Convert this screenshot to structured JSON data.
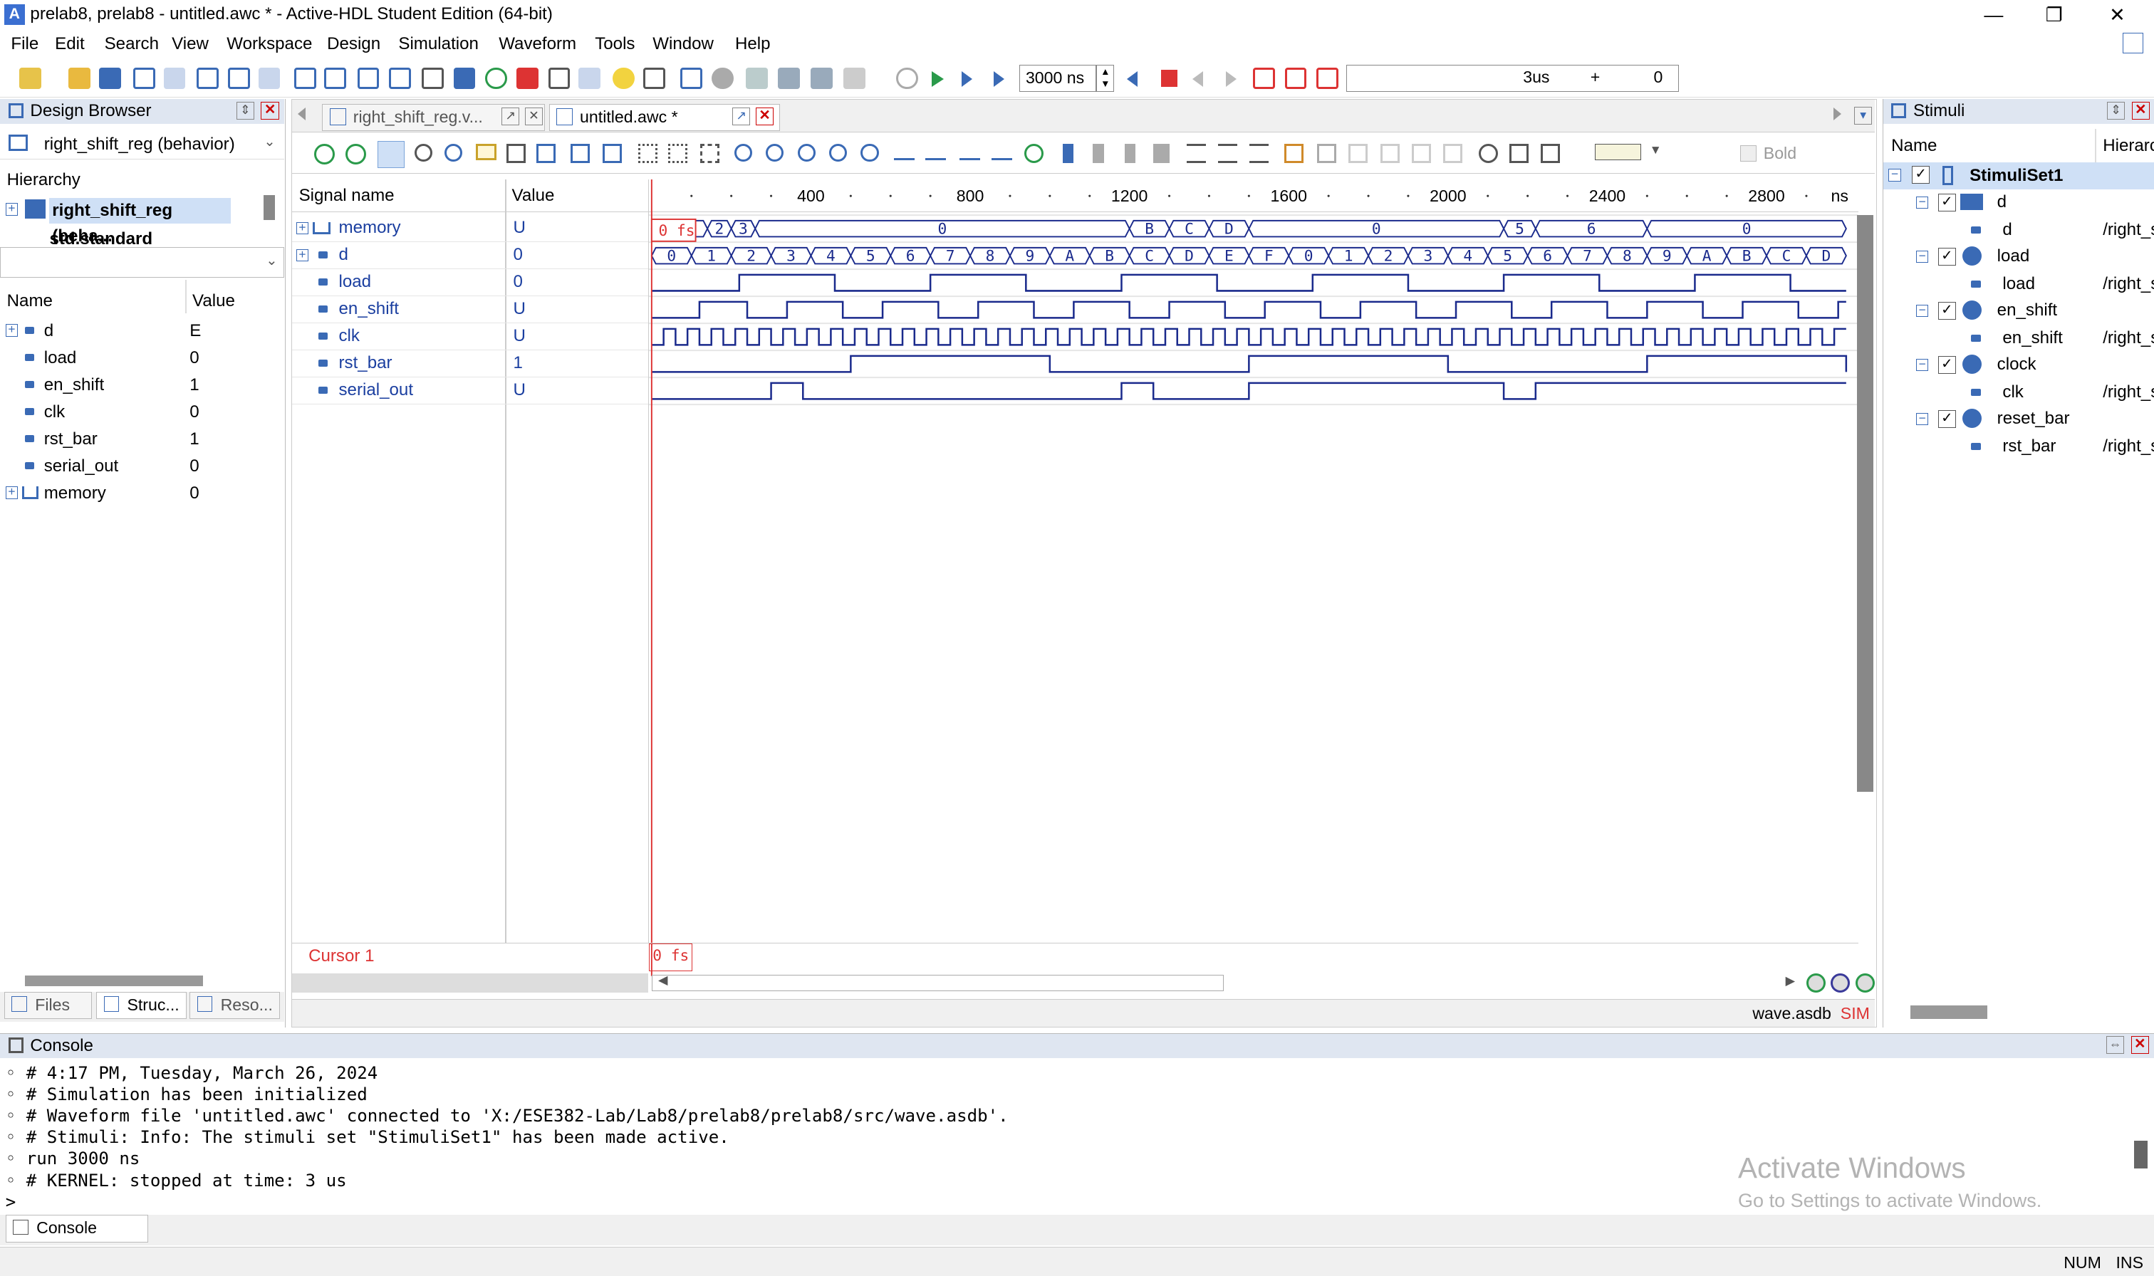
{
  "window": {
    "title": "prelab8, prelab8 - untitled.awc * - Active-HDL Student Edition (64-bit)",
    "minimize": "—",
    "maximize": "❐",
    "close": "✕"
  },
  "menu": [
    "File",
    "Edit",
    "Search",
    "View",
    "Workspace",
    "Design",
    "Simulation",
    "Waveform",
    "Tools",
    "Window",
    "Help"
  ],
  "toolbar": {
    "run_time": "3000 ns",
    "time_display": "3us",
    "plus": "+",
    "counter": "0"
  },
  "design_browser": {
    "title": "Design Browser",
    "top_selector": "right_shift_reg (behavior)",
    "hierarchy_label": "Hierarchy",
    "hierarchy_items": [
      "right_shift_reg (beha...",
      "std.standard"
    ],
    "columns": {
      "name": "Name",
      "value": "Value"
    },
    "signals": [
      {
        "name": "d",
        "value": "E"
      },
      {
        "name": "load",
        "value": "0"
      },
      {
        "name": "en_shift",
        "value": "1"
      },
      {
        "name": "clk",
        "value": "0"
      },
      {
        "name": "rst_bar",
        "value": "1"
      },
      {
        "name": "serial_out",
        "value": "0"
      },
      {
        "name": "memory",
        "value": "0"
      }
    ],
    "tabs": [
      "Files",
      "Struc...",
      "Reso..."
    ]
  },
  "editor_tabs": [
    {
      "label": "right_shift_reg.v..."
    },
    {
      "label": "untitled.awc *"
    }
  ],
  "waveform": {
    "toolbar_bold": "Bold",
    "col_signal": "Signal name",
    "col_value": "Value",
    "time_unit": "ns",
    "ticks": [
      "400",
      "800",
      "1200",
      "1600",
      "2000",
      "2400",
      "2800"
    ],
    "cursor_flag": "0 fs",
    "cursor_name": "Cursor 1",
    "cursor_time": "0 fs",
    "status_file": "wave.asdb",
    "status_mode": "SIM",
    "signals": [
      {
        "name": "memory",
        "value": "U"
      },
      {
        "name": "d",
        "value": "0"
      },
      {
        "name": "load",
        "value": "0"
      },
      {
        "name": "en_shift",
        "value": "U"
      },
      {
        "name": "clk",
        "value": "U"
      },
      {
        "name": "rst_bar",
        "value": "1"
      },
      {
        "name": "serial_out",
        "value": "U"
      }
    ],
    "memory_segments": [
      {
        "start": 0,
        "end": 60,
        "label": "U"
      },
      {
        "start": 60,
        "end": 140,
        "label": ""
      },
      {
        "start": 140,
        "end": 200,
        "label": "2"
      },
      {
        "start": 200,
        "end": 260,
        "label": "3"
      },
      {
        "start": 260,
        "end": 1200,
        "label": "0"
      },
      {
        "start": 1200,
        "end": 1300,
        "label": "B"
      },
      {
        "start": 1300,
        "end": 1400,
        "label": "C"
      },
      {
        "start": 1400,
        "end": 1500,
        "label": "D"
      },
      {
        "start": 1500,
        "end": 2140,
        "label": "0"
      },
      {
        "start": 2140,
        "end": 2220,
        "label": "5"
      },
      {
        "start": 2220,
        "end": 2500,
        "label": "6"
      },
      {
        "start": 2500,
        "end": 3000,
        "label": "0"
      }
    ],
    "d_values": [
      "0",
      "1",
      "2",
      "3",
      "4",
      "5",
      "6",
      "7",
      "8",
      "9",
      "A",
      "B",
      "C",
      "D",
      "E",
      "F",
      "0",
      "1",
      "2",
      "3",
      "4",
      "5",
      "6",
      "7",
      "8",
      "9",
      "A",
      "B",
      "C",
      "D"
    ],
    "load_edges": [
      220,
      460,
      700,
      940,
      1180,
      1420,
      1660,
      1900,
      2140,
      2380,
      2620,
      2860
    ],
    "en_shift_edges": [
      120,
      240,
      340,
      480,
      580,
      720,
      820,
      960,
      1060,
      1200,
      1300,
      1440,
      1540,
      1680,
      1780,
      1920,
      2020,
      2160,
      2260,
      2400,
      2500,
      2640,
      2740,
      2880,
      2980
    ],
    "clk_period": 60,
    "rst_bar_edges": [
      500,
      1000,
      1500,
      2000,
      2500,
      3000
    ],
    "serial_out_edges": [
      300,
      380,
      1180,
      1260,
      1500,
      2140,
      2220
    ]
  },
  "stimuli": {
    "title": "Stimuli",
    "col_name": "Name",
    "col_hier": "Hierarc",
    "set_name": "StimuliSet1",
    "items": [
      {
        "name": "d",
        "child": "d",
        "path": "/right_s"
      },
      {
        "name": "load",
        "child": "load",
        "path": "/right_s"
      },
      {
        "name": "en_shift",
        "child": "en_shift",
        "path": "/right_s"
      },
      {
        "name": "clock",
        "child": "clk",
        "path": "/right_s"
      },
      {
        "name": "reset_bar",
        "child": "rst_bar",
        "path": "/right_s"
      }
    ]
  },
  "console": {
    "title": "Console",
    "lines": [
      "#  4:17 PM, Tuesday, March 26, 2024",
      "#  Simulation has been initialized",
      "# Waveform file 'untitled.awc' connected to 'X:/ESE382-Lab/Lab8/prelab8/prelab8/src/wave.asdb'.",
      "# Stimuli: Info: The stimuli set \"StimuliSet1\" has been made active.",
      "run 3000 ns",
      "# KERNEL: stopped at time: 3 us"
    ],
    "prompt": ">",
    "tab": "Console",
    "watermark_title": "Activate Windows",
    "watermark_sub": "Go to Settings to activate Windows."
  },
  "statusbar": {
    "num": "NUM",
    "ins": "INS"
  },
  "colors": {
    "wave": "#1a2a8c",
    "cursor": "#d33",
    "panel_header": "#dfe6f1"
  }
}
